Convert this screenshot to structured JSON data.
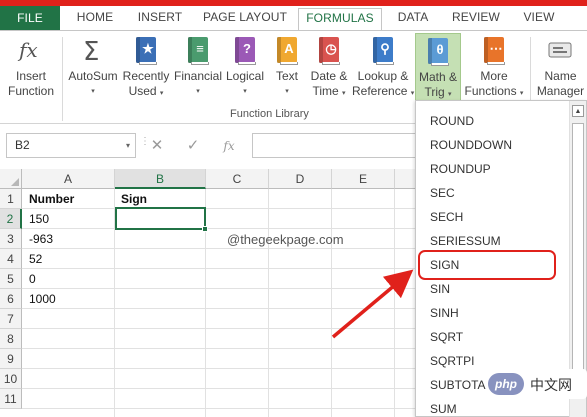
{
  "tabs": {
    "file": "FILE",
    "home": "HOME",
    "insert": "INSERT",
    "page_layout": "PAGE LAYOUT",
    "formulas": "FORMULAS",
    "data": "DATA",
    "review": "REVIEW",
    "view": "VIEW"
  },
  "ribbon": {
    "insert_function": [
      "Insert",
      "Function"
    ],
    "autosum": "AutoSum",
    "recently_used": [
      "Recently",
      "Used"
    ],
    "financial": "Financial",
    "logical": "Logical",
    "text": "Text",
    "date_time": [
      "Date &",
      "Time"
    ],
    "lookup_reference": [
      "Lookup &",
      "Reference"
    ],
    "math_trig": [
      "Math &",
      "Trig"
    ],
    "more_functions": [
      "More",
      "Functions"
    ],
    "name_manager": [
      "Name",
      "Manager"
    ],
    "group_label": "Function Library",
    "caret": "▾"
  },
  "formula_bar": {
    "name_box": "B2",
    "cancel_icon": "✕",
    "enter_icon": "✓",
    "fx_icon": "fx"
  },
  "sheet": {
    "columns": [
      "A",
      "B",
      "C",
      "D",
      "E"
    ],
    "rows": [
      "1",
      "2",
      "3",
      "4",
      "5",
      "6",
      "7",
      "8",
      "9",
      "10",
      "11"
    ],
    "header_a": "Number",
    "header_b": "Sign",
    "values_a": [
      "150",
      "-963",
      "52",
      "0",
      "1000"
    ],
    "watermark": "@thegeekpage.com"
  },
  "dropdown": {
    "items": [
      "ROUND",
      "ROUNDDOWN",
      "ROUNDUP",
      "SEC",
      "SECH",
      "SERIESSUM",
      "SIGN",
      "SIN",
      "SINH",
      "SQRT",
      "SQRTPI",
      "SUBTOTAL",
      "SUM"
    ],
    "highlighted": "SIGN"
  },
  "badge": {
    "logo": "php",
    "text": "中文网"
  },
  "colors": {
    "excel_green": "#217346",
    "annotation_red": "#e0211b",
    "math_highlight": "#c5e0b4"
  }
}
